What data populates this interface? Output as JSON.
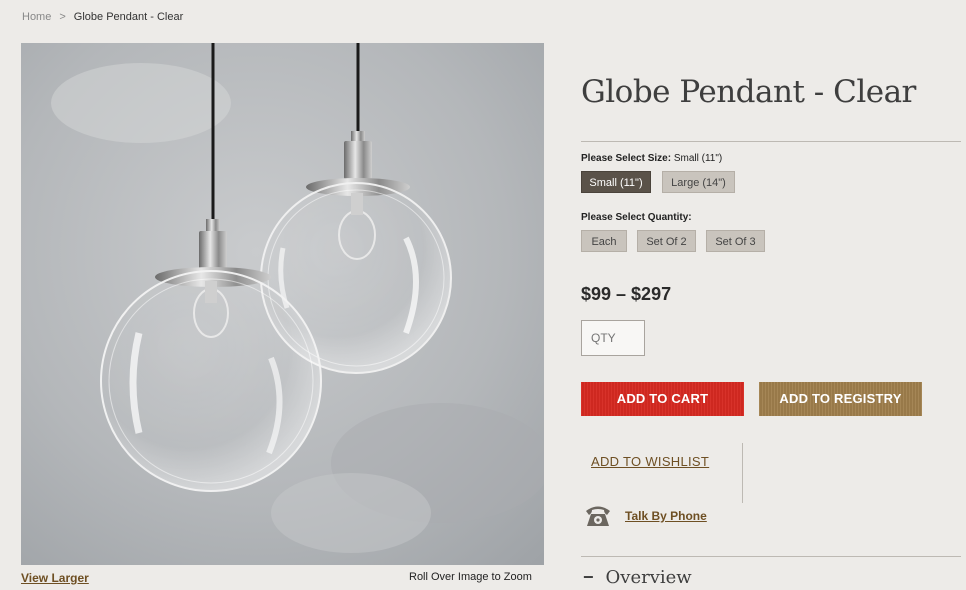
{
  "breadcrumb": {
    "home": "Home",
    "separator": ">",
    "current": "Globe Pendant - Clear"
  },
  "product": {
    "title": "Globe Pendant - Clear",
    "image_alt": "two clear glass globe pendant lights",
    "view_larger": "View Larger",
    "zoom_hint": "Roll Over Image to Zoom"
  },
  "size": {
    "label": "Please Select Size:",
    "selected": "Small (11\")",
    "options": [
      "Small (11\")",
      "Large (14\")"
    ]
  },
  "quantity_options": {
    "label": "Please Select Quantity:",
    "options": [
      "Each",
      "Set Of 2",
      "Set Of 3"
    ]
  },
  "price": "$99 – $297",
  "qty_placeholder": "QTY",
  "buttons": {
    "add_to_cart": "ADD TO CART",
    "add_to_registry": "ADD TO REGISTRY"
  },
  "links": {
    "wishlist": "ADD TO WISHLIST",
    "talk_by_phone": "Talk By Phone"
  },
  "overview": {
    "toggle": "−",
    "label": "Overview"
  },
  "colors": {
    "accent_cart": "#d62a21",
    "accent_registry": "#a07f4d",
    "link": "#6e4f23",
    "selected_option": "#5a5249"
  }
}
